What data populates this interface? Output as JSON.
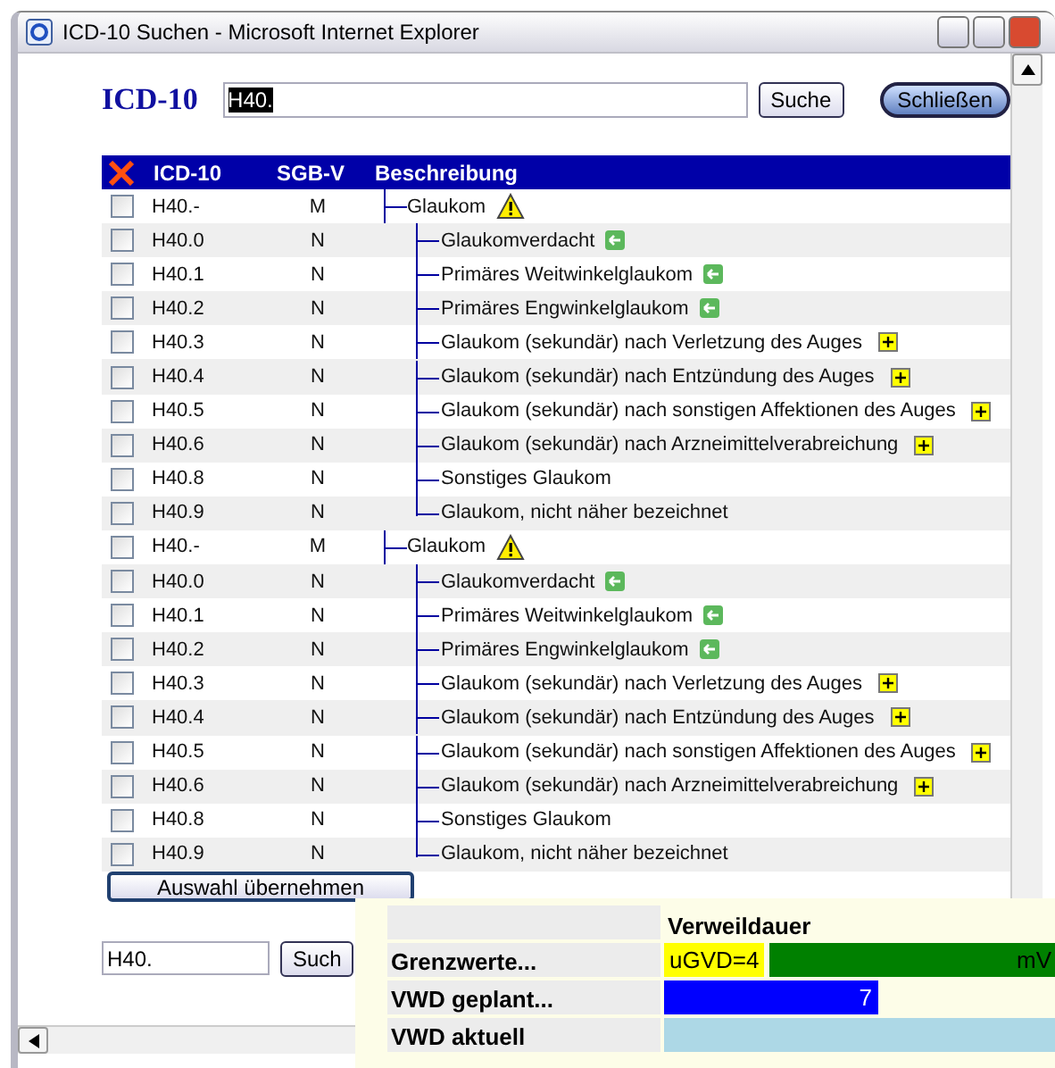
{
  "window": {
    "title": "ICD-10 Suchen - Microsoft Internet Explorer"
  },
  "search": {
    "label": "ICD-10",
    "value": "H40.",
    "button": "Suche",
    "close_button": "Schließen"
  },
  "table": {
    "columns": [
      "ICD-10",
      "SGB-V",
      "Beschreibung"
    ],
    "groups": [
      {
        "code": "H40.-",
        "sgb": "M",
        "label": "Glaukom",
        "kind": "alert",
        "checked": false,
        "children": [
          {
            "code": "H40.0",
            "sgb": "N",
            "label": "Glaukomverdacht",
            "kind": "reference",
            "checked": false
          },
          {
            "code": "H40.1",
            "sgb": "N",
            "label": "Primäres Weitwinkelglaukom",
            "kind": "reference",
            "checked": false
          },
          {
            "code": "H40.2",
            "sgb": "N",
            "label": "Primäres Engwinkelglaukom",
            "kind": "reference",
            "checked": false
          },
          {
            "code": "H40.3",
            "sgb": "N",
            "label": "Glaukom (sekundär) nach Verletzung des Auges",
            "kind": "expandable",
            "checked": false
          },
          {
            "code": "H40.4",
            "sgb": "N",
            "label": "Glaukom (sekundär) nach Entzündung des Auges",
            "kind": "expandable",
            "checked": false
          },
          {
            "code": "H40.5",
            "sgb": "N",
            "label": "Glaukom (sekundär) nach sonstigen Affektionen des Auges",
            "kind": "expandable",
            "checked": false
          },
          {
            "code": "H40.6",
            "sgb": "N",
            "label": "Glaukom (sekundär) nach Arzneimittelverabreichung",
            "kind": "expandable",
            "checked": false
          },
          {
            "code": "H40.8",
            "sgb": "N",
            "label": "Sonstiges Glaukom",
            "kind": "plain",
            "checked": false
          },
          {
            "code": "H40.9",
            "sgb": "N",
            "label": "Glaukom, nicht näher bezeichnet",
            "kind": "plain",
            "checked": false
          }
        ]
      },
      {
        "code": "H40.-",
        "sgb": "M",
        "label": "Glaukom",
        "kind": "alert",
        "checked": false,
        "children": [
          {
            "code": "H40.0",
            "sgb": "N",
            "label": "Glaukomverdacht",
            "kind": "reference",
            "checked": false
          },
          {
            "code": "H40.1",
            "sgb": "N",
            "label": "Primäres Weitwinkelglaukom",
            "kind": "reference",
            "checked": false
          },
          {
            "code": "H40.2",
            "sgb": "N",
            "label": "Primäres Engwinkelglaukom",
            "kind": "reference",
            "checked": false
          },
          {
            "code": "H40.3",
            "sgb": "N",
            "label": "Glaukom (sekundär) nach Verletzung des Auges",
            "kind": "expandable",
            "checked": false
          },
          {
            "code": "H40.4",
            "sgb": "N",
            "label": "Glaukom (sekundär) nach Entzündung des Auges",
            "kind": "expandable",
            "checked": false
          },
          {
            "code": "H40.5",
            "sgb": "N",
            "label": "Glaukom (sekundär) nach sonstigen Affektionen des Auges",
            "kind": "expandable",
            "checked": false
          },
          {
            "code": "H40.6",
            "sgb": "N",
            "label": "Glaukom (sekundär) nach Arzneimittelverabreichung",
            "kind": "expandable",
            "checked": false
          },
          {
            "code": "H40.8",
            "sgb": "N",
            "label": "Sonstiges Glaukom",
            "kind": "plain",
            "checked": false
          },
          {
            "code": "H40.9",
            "sgb": "N",
            "label": "Glaukom, nicht näher bezeichnet",
            "kind": "plain",
            "checked": false
          }
        ]
      }
    ]
  },
  "apply_button": "Auswahl übernehmen",
  "bottom_search": {
    "value": "H40.",
    "button": "Such"
  },
  "overlay": {
    "heading": "Verweildauer",
    "rows": [
      {
        "kind": "limits",
        "label": "Grenzwerte...",
        "low": "uGVD=4",
        "high": "mV"
      },
      {
        "kind": "bar",
        "label": "VWD geplant...",
        "value": "7",
        "level": 0.55,
        "color": "#0000ff"
      },
      {
        "kind": "band",
        "label": "VWD aktuell",
        "color": "#add8e6"
      }
    ]
  }
}
